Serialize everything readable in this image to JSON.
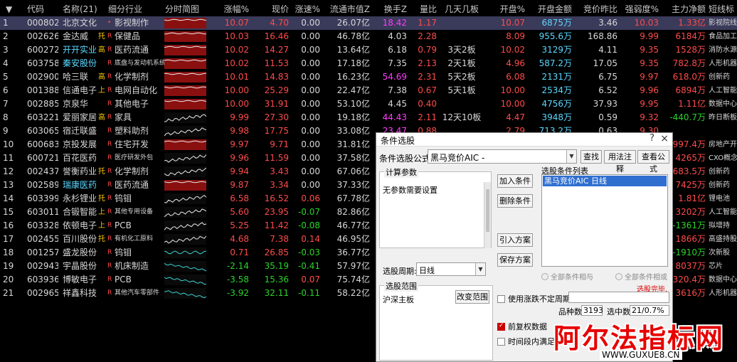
{
  "headers": {
    "sort_icon": "▼",
    "code": "代码",
    "name": "名称(21)",
    "industry": "细分行业",
    "timeline": "分时简图",
    "change_pct": "涨幅%",
    "price": "现价",
    "speed": "涨速%",
    "float_cap": "流通市值Z",
    "turnover": "换手Z",
    "vol_ratio": "量比",
    "boards": "几天几板",
    "open_pct": "开盘%",
    "open_amt": "开盘金额",
    "auction_ratio": "竞价昨比",
    "strength": "强弱度%",
    "net_flow": "主力净额",
    "short_tag": "短线标"
  },
  "rows": [
    {
      "idx": "1",
      "code": "000802",
      "name": "北京文化",
      "ntag": "",
      "industry": "影视制作",
      "chg": "10.07",
      "price": "4.70",
      "speed": "0.00",
      "cap": "26.07亿",
      "turn": "18.42",
      "vr": "1.17",
      "boards": "",
      "open": "10.07",
      "oamt": "6875万",
      "auc": "3.46",
      "str": "10.03",
      "flow": "1.33亿",
      "st": "影视院线",
      "trend": "up"
    },
    {
      "idx": "2",
      "code": "002626",
      "name": "金达威",
      "ntag": "托",
      "industry": "保健品",
      "chg": "10.03",
      "price": "16.46",
      "speed": "0.00",
      "cap": "46.78亿",
      "turn": "4.03",
      "vr": "2.28",
      "boards": "",
      "open": "8.09",
      "oamt": "955.6万",
      "auc": "168.86",
      "str": "9.99",
      "flow": "6184万",
      "st": "食品加工",
      "trend": "up"
    },
    {
      "idx": "3",
      "code": "600272",
      "name": "开开实业",
      "ntag": "高",
      "industry": "医药流通",
      "chg": "10.02",
      "price": "14.27",
      "speed": "0.00",
      "cap": "13.64亿",
      "turn": "6.18",
      "vr": "0.79",
      "boards": "3天2板",
      "open": "10.02",
      "oamt": "3129万",
      "auc": "4.11",
      "str": "9.35",
      "flow": "1528万",
      "st": "消防水源",
      "trend": "up"
    },
    {
      "idx": "4",
      "code": "603758",
      "name": "秦安股份",
      "ntag": "",
      "industry": "底盘与发动机系统",
      "chg": "10.02",
      "price": "11.53",
      "speed": "0.00",
      "cap": "17.18亿",
      "turn": "7.35",
      "vr": "2.13",
      "boards": "2天1板",
      "open": "4.96",
      "oamt": "587.2万",
      "auc": "17.05",
      "str": "9.35",
      "flow": "782.8万",
      "st": "人形机器",
      "trend": "up"
    },
    {
      "idx": "5",
      "code": "002900",
      "name": "哈三联",
      "ntag": "高",
      "industry": "化学制剂",
      "chg": "10.01",
      "price": "14.83",
      "speed": "0.00",
      "cap": "16.23亿",
      "turn": "54.69",
      "vr": "2.31",
      "boards": "5天2板",
      "open": "6.08",
      "oamt": "2131万",
      "auc": "6.75",
      "str": "9.97",
      "flow": "618.0万",
      "st": "创新药",
      "trend": "up"
    },
    {
      "idx": "6",
      "code": "001388",
      "name": "信通电子",
      "ntag": "上",
      "industry": "电网自动化",
      "chg": "10.00",
      "price": "25.29",
      "speed": "0.00",
      "cap": "22.47亿",
      "turn": "7.38",
      "vr": "0.67",
      "boards": "5天1板",
      "open": "10.00",
      "oamt": "2534万",
      "auc": "6.52",
      "str": "9.96",
      "flow": "6894万",
      "st": "人工智能",
      "trend": "up"
    },
    {
      "idx": "7",
      "code": "002885",
      "name": "京泉华",
      "ntag": "",
      "industry": "其他电子",
      "chg": "10.00",
      "price": "31.91",
      "speed": "0.00",
      "cap": "53.10亿",
      "turn": "4.45",
      "vr": "0.40",
      "boards": "",
      "open": "10.00",
      "oamt": "4756万",
      "auc": "37.93",
      "str": "9.95",
      "flow": "1.11亿",
      "st": "数据中心",
      "trend": "up"
    },
    {
      "idx": "8",
      "code": "603221",
      "name": "爱丽家居",
      "ntag": "高",
      "industry": "家具",
      "chg": "9.99",
      "price": "27.30",
      "speed": "0.00",
      "cap": "19.18亿",
      "turn": "44.43",
      "vr": "2.11",
      "boards": "12天10板",
      "open": "4.47",
      "oamt": "3948万",
      "auc": "0.59",
      "str": "9.32",
      "flow": "-440.7万",
      "st": "昨日断板",
      "trend": "wave"
    },
    {
      "idx": "9",
      "code": "603065",
      "name": "宿迁联盛",
      "ntag": "",
      "industry": "塑料助剂",
      "chg": "9.98",
      "price": "17.75",
      "speed": "0.00",
      "cap": "33.08亿",
      "turn": "23.47",
      "vr": "0.88",
      "boards": "",
      "open": "2.79",
      "oamt": "713.2万",
      "auc": "0.63",
      "str": "9.30",
      "flow": "",
      "st": "",
      "trend": "wave"
    },
    {
      "idx": "10",
      "code": "600683",
      "name": "京投发展",
      "ntag": "",
      "industry": "住宅开发",
      "chg": "9.97",
      "price": "9.71",
      "speed": "0.00",
      "cap": "31.81亿",
      "turn": "",
      "vr": "",
      "boards": "",
      "open": "",
      "oamt": "",
      "auc": "",
      "str": "",
      "flow": "997.4万",
      "st": "房地产开发",
      "trend": "up"
    },
    {
      "idx": "11",
      "code": "600721",
      "name": "百花医药",
      "ntag": "",
      "industry": "医疗研发外包",
      "chg": "9.96",
      "price": "11.59",
      "speed": "0.00",
      "cap": "37.58亿",
      "turn": "",
      "vr": "",
      "boards": "",
      "open": "",
      "oamt": "",
      "auc": "",
      "str": "",
      "flow": "4265万",
      "st": "CXO概念",
      "trend": "wave"
    },
    {
      "idx": "12",
      "code": "002437",
      "name": "誉衡药业",
      "ntag": "托",
      "industry": "化学制剂",
      "chg": "9.94",
      "price": "3.43",
      "speed": "0.00",
      "cap": "67.06亿",
      "turn": "",
      "vr": "",
      "boards": "",
      "open": "",
      "oamt": "",
      "auc": "",
      "str": "",
      "flow": "683.5万",
      "st": "创新药",
      "trend": "wave"
    },
    {
      "idx": "13",
      "code": "002589",
      "name": "瑞康医药",
      "ntag": "",
      "industry": "医药流通",
      "chg": "9.87",
      "price": "3.34",
      "speed": "0.00",
      "cap": "37.33亿",
      "turn": "",
      "vr": "",
      "boards": "",
      "open": "",
      "oamt": "",
      "auc": "",
      "str": "",
      "flow": "7425万",
      "st": "创新药",
      "trend": "up"
    },
    {
      "idx": "14",
      "code": "603399",
      "name": "永杉锂业",
      "ntag": "托",
      "industry": "钨钼",
      "chg": "6.58",
      "price": "16.52",
      "speed": "0.06",
      "cap": "67.78亿",
      "turn": "",
      "vr": "",
      "boards": "",
      "open": "",
      "oamt": "",
      "auc": "",
      "str": "",
      "flow": "1.81亿",
      "st": "锂电池",
      "trend": "wave"
    },
    {
      "idx": "15",
      "code": "603011",
      "name": "合锻智能",
      "ntag": "上",
      "industry": "其他专用设备",
      "chg": "5.60",
      "price": "23.95",
      "speed": "-0.07",
      "cap": "82.86亿",
      "turn": "",
      "vr": "",
      "boards": "",
      "open": "",
      "oamt": "",
      "auc": "",
      "str": "",
      "flow": "3202万",
      "st": "人工智能",
      "trend": "wave"
    },
    {
      "idx": "16",
      "code": "603328",
      "name": "依顿电子",
      "ntag": "上",
      "industry": "PCB",
      "chg": "5.25",
      "price": "11.42",
      "speed": "-0.08",
      "cap": "46.77亿",
      "turn": "",
      "vr": "",
      "boards": "",
      "open": "",
      "oamt": "",
      "auc": "",
      "str": "",
      "flow": "-1361万",
      "st": "拟增持",
      "trend": "wave"
    },
    {
      "idx": "17",
      "code": "002455",
      "name": "百川股份",
      "ntag": "托",
      "industry": "有机化工原料",
      "chg": "4.68",
      "price": "7.38",
      "speed": "0.14",
      "cap": "46.95亿",
      "turn": "",
      "vr": "",
      "boards": "",
      "open": "",
      "oamt": "",
      "auc": "",
      "str": "",
      "flow": "1866万",
      "st": "高盛持股",
      "trend": "wave"
    },
    {
      "idx": "18",
      "code": "001257",
      "name": "盛龙股份",
      "ntag": "",
      "industry": "钨钼",
      "chg": "0.71",
      "price": "26.85",
      "speed": "-0.03",
      "cap": "36.77亿",
      "turn": "",
      "vr": "",
      "boards": "",
      "open": "",
      "oamt": "",
      "auc": "",
      "str": "",
      "flow": "-1910万",
      "st": "次新股",
      "trend": "flat"
    },
    {
      "idx": "19",
      "code": "002943",
      "name": "宇晶股份",
      "ntag": "",
      "industry": "机床制造",
      "chg": "-2.14",
      "price": "35.19",
      "speed": "-0.41",
      "cap": "57.97亿",
      "turn": "",
      "vr": "",
      "boards": "",
      "open": "",
      "oamt": "",
      "auc": "",
      "str": "",
      "flow": "8037万",
      "st": "芯片",
      "trend": "down"
    },
    {
      "idx": "20",
      "code": "603936",
      "name": "博敏电子",
      "ntag": "",
      "industry": "PCB",
      "chg": "-3.58",
      "price": "15.36",
      "speed": "0.07",
      "cap": "75.74亿",
      "turn": "",
      "vr": "",
      "boards": "",
      "open": "",
      "oamt": "",
      "auc": "",
      "str": "",
      "flow": "320.4万",
      "st": "数据中心",
      "trend": "down"
    },
    {
      "idx": "21",
      "code": "002965",
      "name": "祥鑫科技",
      "ntag": "",
      "industry": "其他汽车零部件",
      "chg": "-3.92",
      "price": "32.11",
      "speed": "-0.11",
      "cap": "58.22亿",
      "turn": "",
      "vr": "",
      "boards": "",
      "open": "",
      "oamt": "",
      "auc": "",
      "str": "",
      "flow": "3616万",
      "st": "人形机器",
      "trend": "down"
    }
  ],
  "dialog": {
    "title": "条件选股",
    "help_icon": "?",
    "close_icon": "×",
    "formula_label": "条件选股公式",
    "formula_value": "黑马竞价AIC  -",
    "find_btn": "查找",
    "usage_btn": "用法注释",
    "view_btn": "查看公式",
    "params_group": "计算参数",
    "params_text": "无参数需要设置",
    "add_btn": "加入条件",
    "del_btn": "删除条件",
    "import_btn": "引入方案",
    "save_btn": "保存方案",
    "cond_list_label": "选股条件列表",
    "cond_item": "黑马竞价AIC  日线",
    "period_label": "选股周期:",
    "period_value": "日线",
    "radio_and": "全部条件相与",
    "radio_or": "全部条件相或",
    "done_text": "选股完毕.",
    "range_group": "选股范围",
    "range_value": "沪深主板",
    "change_range_btn": "改变范围",
    "use_period_label": "使用涨跌不定周期",
    "species_label": "品种数",
    "species_value": "3193",
    "hit_label": "选中数",
    "hit_value": "21/0.7%",
    "pre_restore_label": "前复权数据",
    "time_label": "时间段内满足"
  },
  "watermark": {
    "main": "阿尔法指标网",
    "url": "WWW.GUXUE8.CN"
  }
}
